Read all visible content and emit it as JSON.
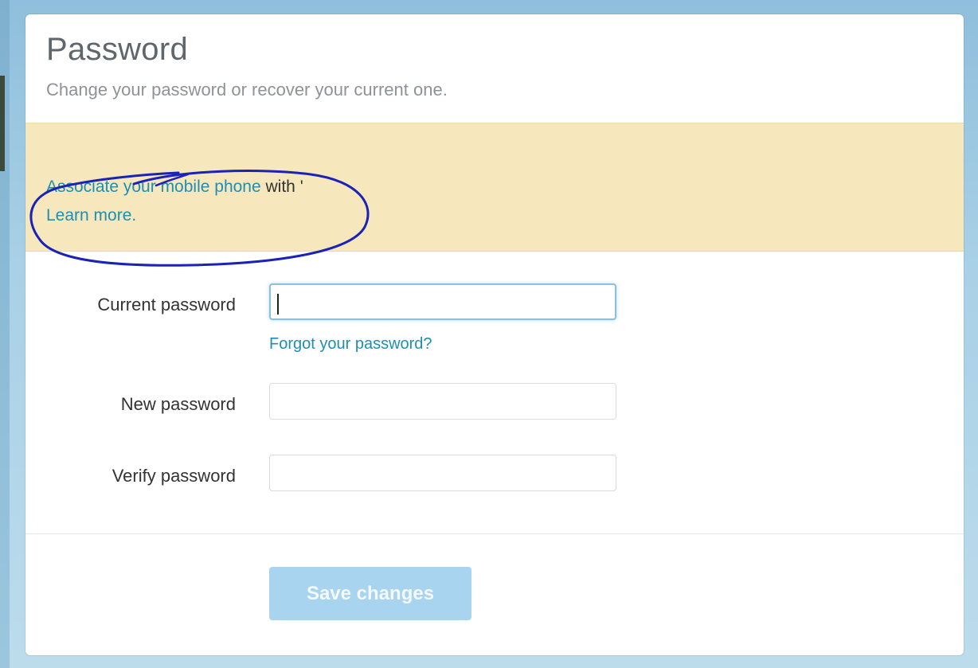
{
  "header": {
    "title": "Password",
    "subtitle": "Change your password or recover your current one."
  },
  "banner": {
    "associate_link": "Associate your mobile phone",
    "associate_tail": "with",
    "cut_fragment": "'",
    "learn_more": "Learn more",
    "learn_more_suffix": ".",
    "background_color": "#f6e7bd",
    "annotation_color": "#1a22b8"
  },
  "form": {
    "current_password_label": "Current password",
    "current_password_value": "",
    "forgot_password_link": "Forgot your password?",
    "new_password_label": "New password",
    "new_password_value": "",
    "verify_password_label": "Verify password",
    "verify_password_value": ""
  },
  "actions": {
    "save_label": "Save changes"
  },
  "colors": {
    "link": "#1e8fb3",
    "save_button_disabled": "#a8d4f0",
    "focus_border": "#8ebfd6"
  }
}
